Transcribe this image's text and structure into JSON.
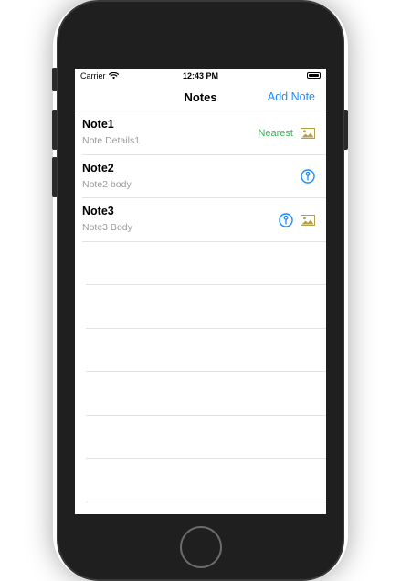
{
  "status_bar": {
    "carrier": "Carrier",
    "time": "12:43 PM"
  },
  "nav": {
    "title": "Notes",
    "action_label": "Add Note",
    "action_color": "#1a8cff"
  },
  "notes": [
    {
      "title": "Note1",
      "detail": "Note Details1",
      "badge": "Nearest",
      "icons": [
        "photo-icon"
      ]
    },
    {
      "title": "Note2",
      "detail": "Note2 body",
      "icons": [
        "location-pin-icon"
      ]
    },
    {
      "title": "Note3",
      "detail": "Note3 Body",
      "icons": [
        "location-pin-icon",
        "photo-icon"
      ]
    }
  ],
  "colors": {
    "accent": "#1a8cff",
    "nearest": "#2ebd4a",
    "photo": "#b3a14a",
    "subtitle": "#9b9b9b"
  }
}
